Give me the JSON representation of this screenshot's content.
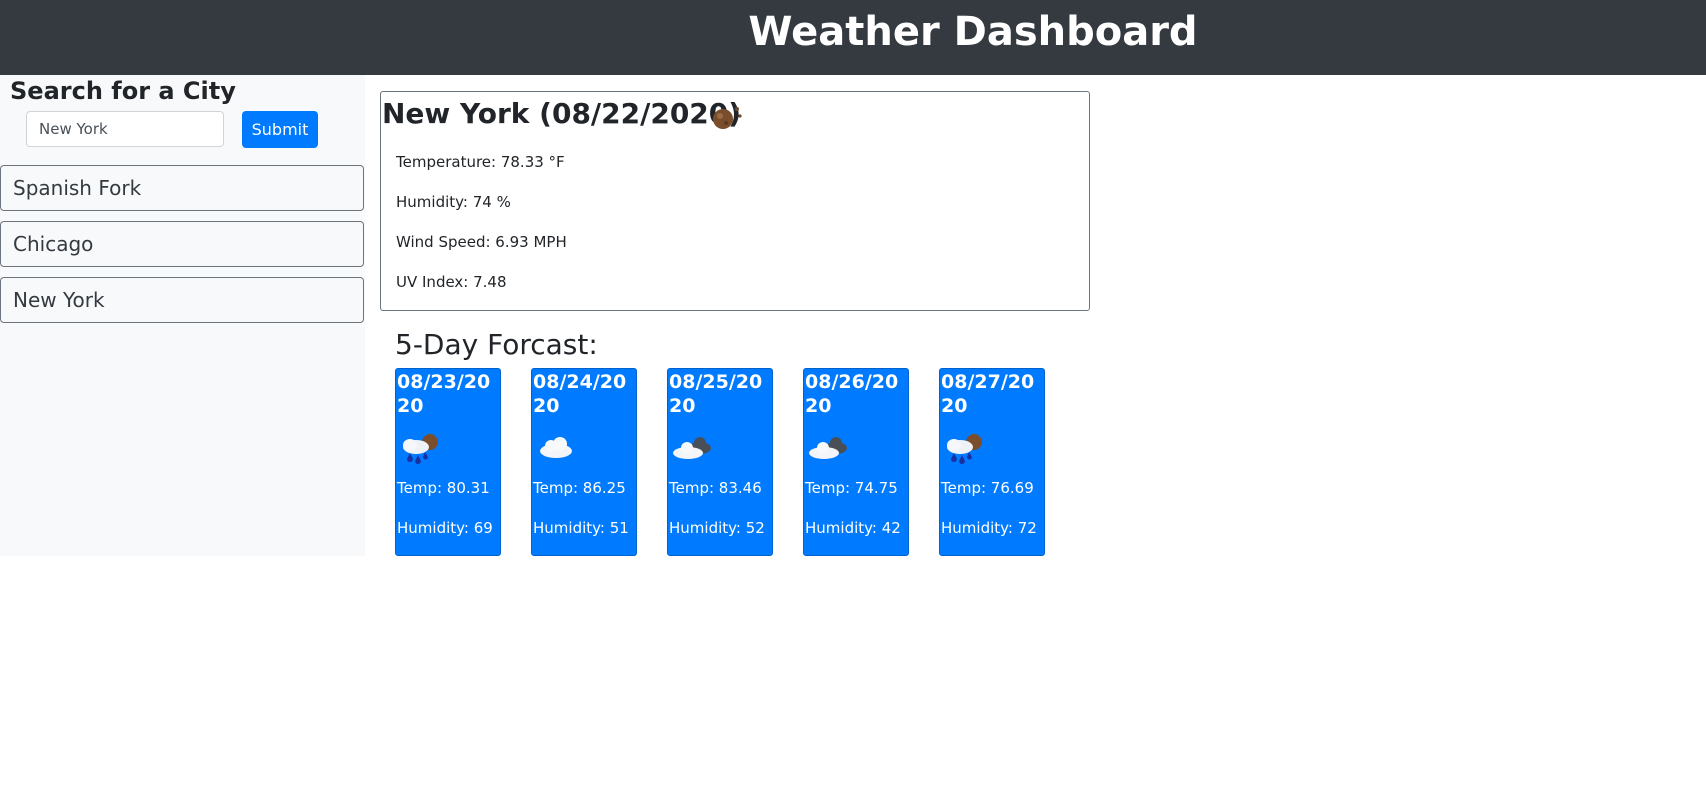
{
  "header": {
    "title": "Weather Dashboard"
  },
  "search": {
    "title": "Search for a City",
    "input_value": "New York",
    "submit_label": "Submit"
  },
  "history": [
    {
      "label": "Spanish Fork"
    },
    {
      "label": "Chicago"
    },
    {
      "label": "New York"
    }
  ],
  "current": {
    "title": "New York (08/22/2020)",
    "icon": "clear-night-moon-icon",
    "temperature": "Temperature: 78.33 °F",
    "humidity": "Humidity: 74 %",
    "wind": "Wind Speed: 6.93 MPH",
    "uv": "UV Index: 7.48"
  },
  "forecast": {
    "title": "5-Day Forcast:",
    "days": [
      {
        "date": "08/23/2020",
        "icon": "rain-night-icon",
        "temp": "Temp: 80.31",
        "humidity": "Humidity: 69"
      },
      {
        "date": "08/24/2020",
        "icon": "cloud-icon",
        "temp": "Temp: 86.25",
        "humidity": "Humidity: 51"
      },
      {
        "date": "08/25/2020",
        "icon": "broken-clouds-icon",
        "temp": "Temp: 83.46",
        "humidity": "Humidity: 52"
      },
      {
        "date": "08/26/2020",
        "icon": "broken-clouds-icon",
        "temp": "Temp: 74.75",
        "humidity": "Humidity: 42"
      },
      {
        "date": "08/27/2020",
        "icon": "rain-night-icon",
        "temp": "Temp: 76.69",
        "humidity": "Humidity: 72"
      }
    ]
  },
  "colors": {
    "header_bg": "#343a40",
    "accent": "#007bff",
    "sidebar_bg": "#f8f9fa"
  }
}
